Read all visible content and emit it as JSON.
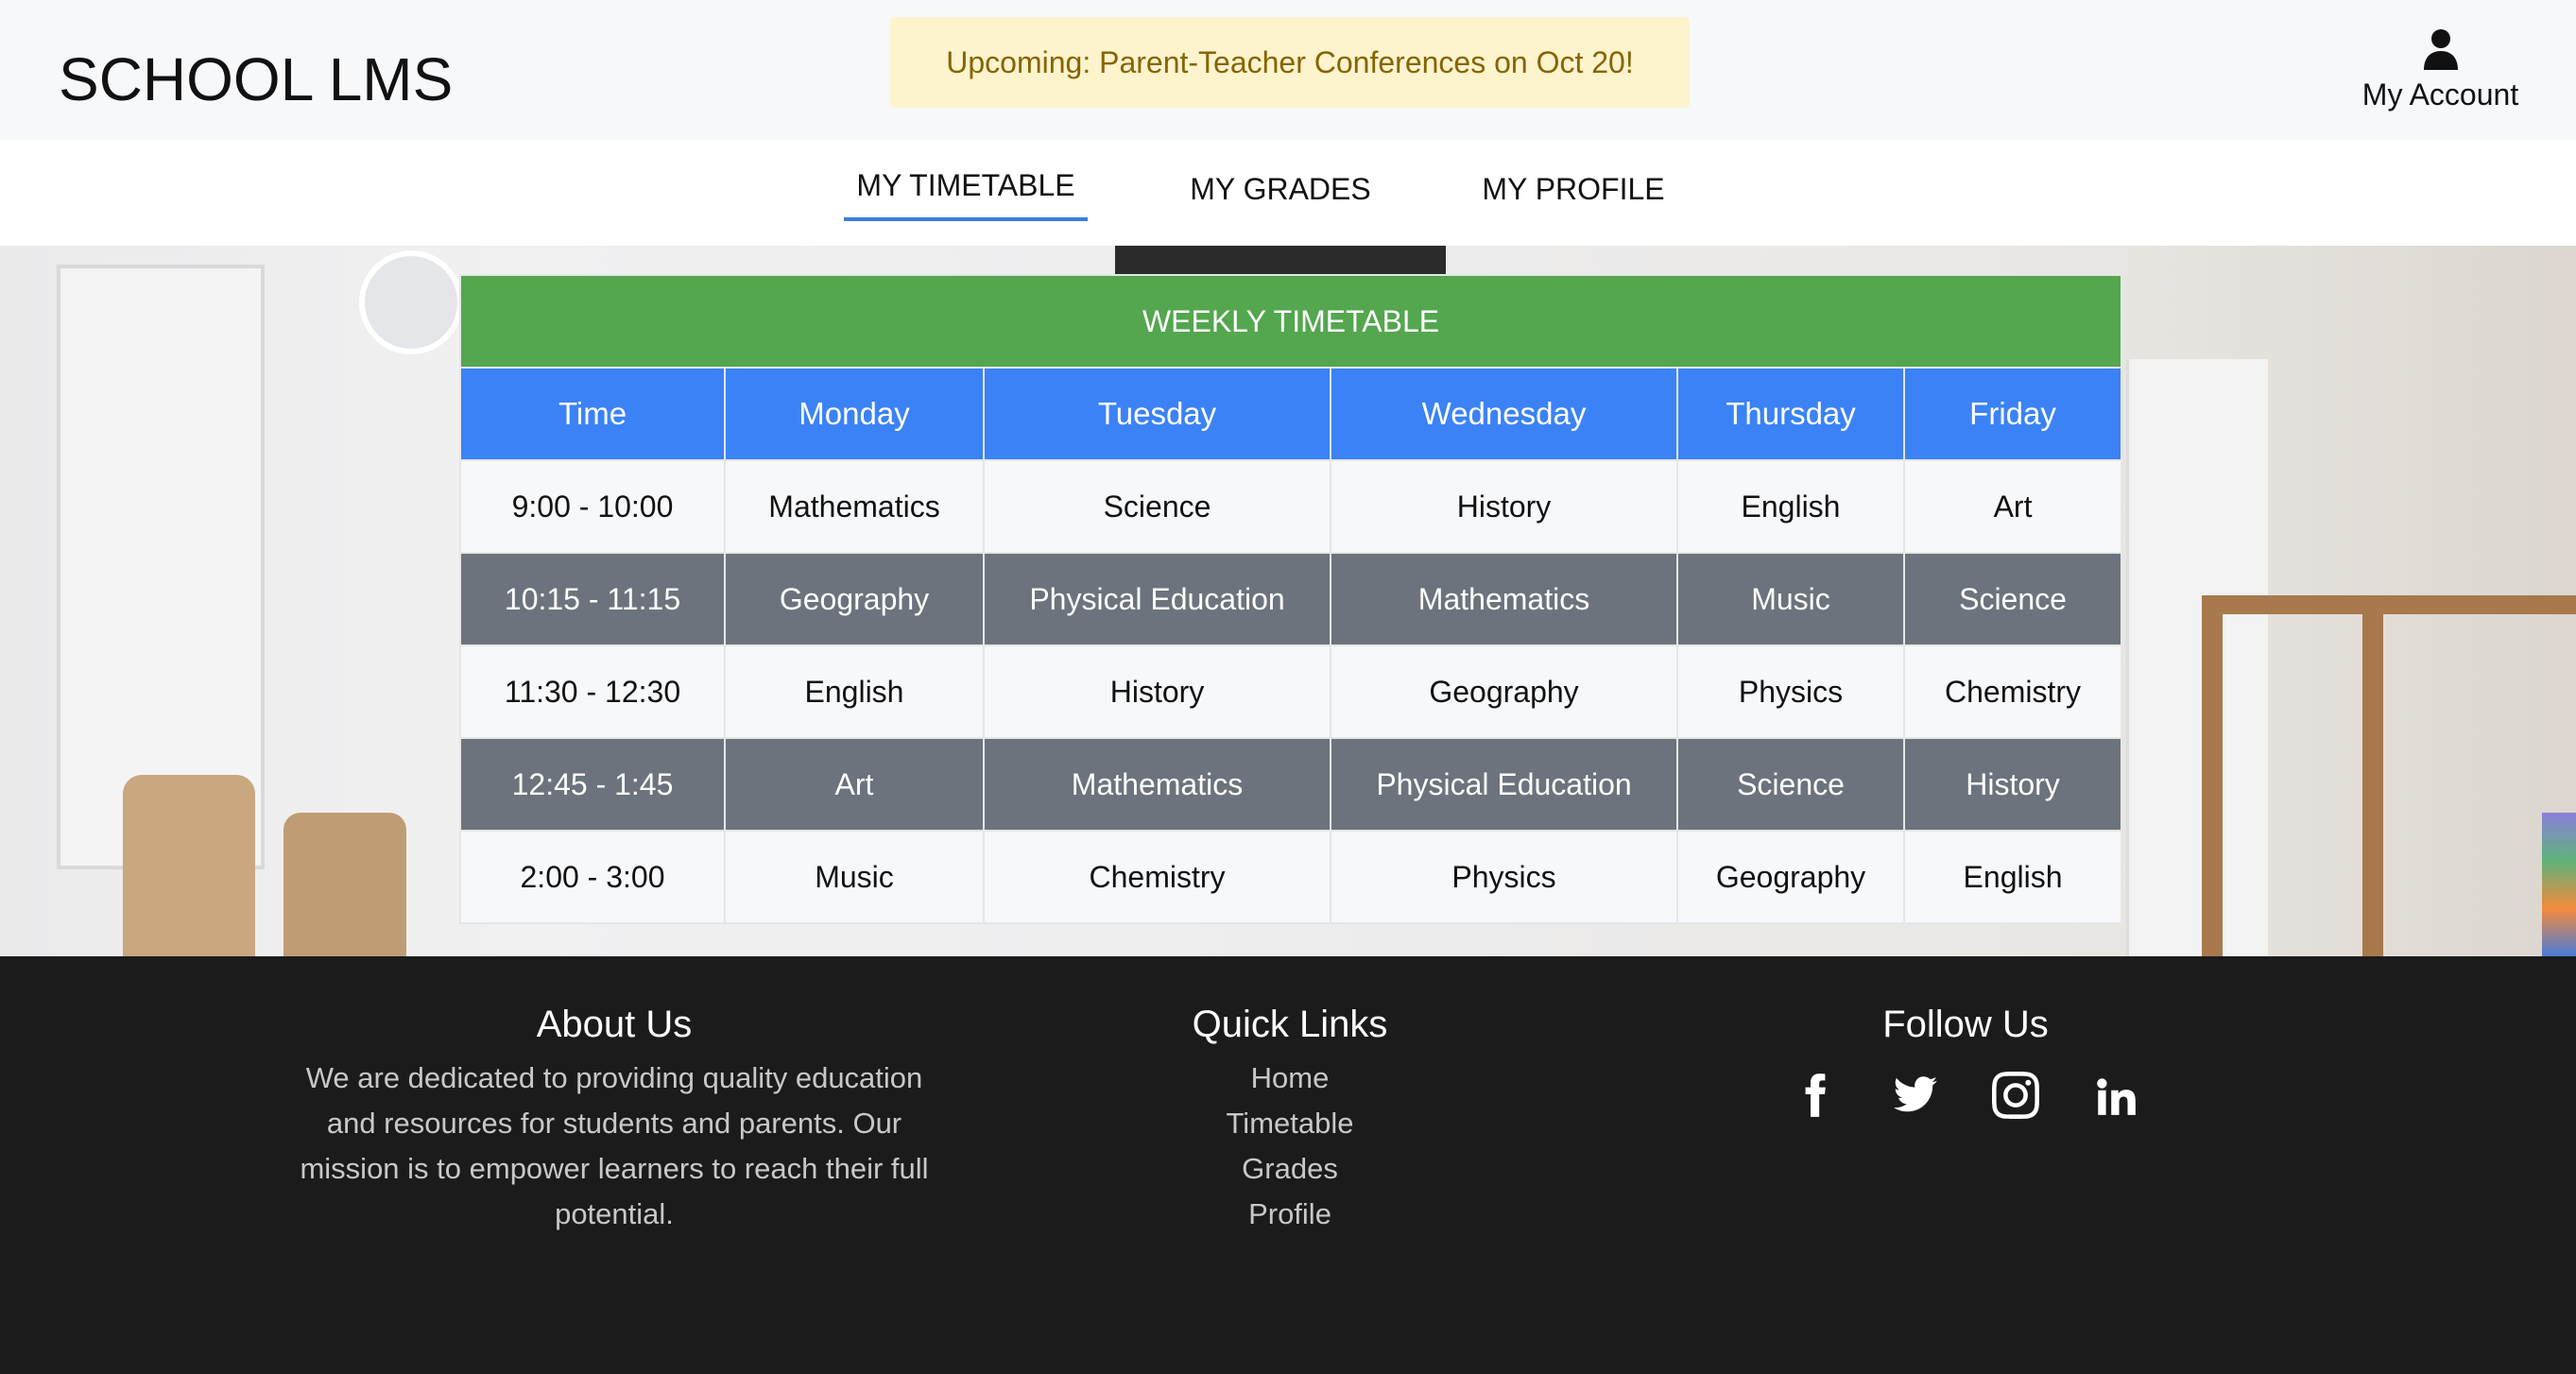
{
  "header": {
    "logo": "SCHOOL LMS",
    "announcement": "Upcoming: Parent-Teacher Conferences on Oct 20!",
    "account_label": "My Account"
  },
  "nav": {
    "tabs": [
      {
        "label": "MY TIMETABLE",
        "active": true
      },
      {
        "label": "MY GRADES",
        "active": false
      },
      {
        "label": "MY PROFILE",
        "active": false
      }
    ]
  },
  "timetable": {
    "title": "WEEKLY TIMETABLE",
    "columns": [
      "Time",
      "Monday",
      "Tuesday",
      "Wednesday",
      "Thursday",
      "Friday"
    ],
    "rows": [
      [
        "9:00 - 10:00",
        "Mathematics",
        "Science",
        "History",
        "English",
        "Art"
      ],
      [
        "10:15 - 11:15",
        "Geography",
        "Physical Education",
        "Mathematics",
        "Music",
        "Science"
      ],
      [
        "11:30 - 12:30",
        "English",
        "History",
        "Geography",
        "Physics",
        "Chemistry"
      ],
      [
        "12:45 - 1:45",
        "Art",
        "Mathematics",
        "Physical Education",
        "Science",
        "History"
      ],
      [
        "2:00 - 3:00",
        "Music",
        "Chemistry",
        "Physics",
        "Geography",
        "English"
      ]
    ]
  },
  "footer": {
    "about": {
      "heading": "About Us",
      "text": "We are dedicated to providing quality education and resources for students and parents. Our mission is to empower learners to reach their full potential."
    },
    "quick_links": {
      "heading": "Quick Links",
      "items": [
        "Home",
        "Timetable",
        "Grades",
        "Profile"
      ]
    },
    "follow": {
      "heading": "Follow Us",
      "icons": [
        "facebook-icon",
        "twitter-icon",
        "instagram-icon",
        "linkedin-icon"
      ]
    }
  },
  "colors": {
    "title_bar": "#54a64f",
    "header_row": "#3b82f6",
    "dark_row": "#6c737c",
    "active_tab_underline": "#3b7ddd",
    "announcement_bg": "#fdf3cc",
    "footer_bg": "#1b1b1b"
  }
}
